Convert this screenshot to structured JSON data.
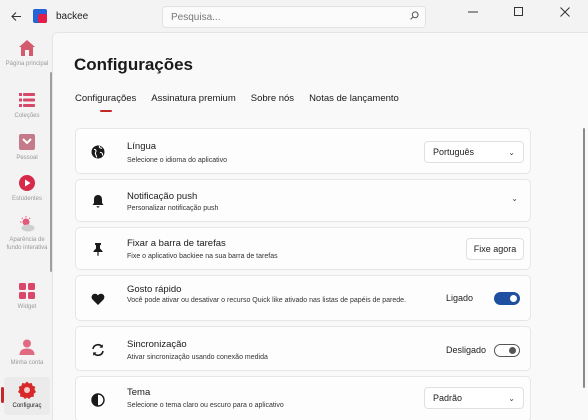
{
  "app": {
    "title": "backee"
  },
  "search": {
    "placeholder": "Pesquisa..."
  },
  "sidebar": {
    "items": [
      {
        "label": "Página principal",
        "icon": "home-icon"
      },
      {
        "label": "Coleções",
        "icon": "collections-icon"
      },
      {
        "label": "Pessoal",
        "icon": "personal-icon"
      },
      {
        "label": "Estúdentes",
        "icon": "play-icon"
      },
      {
        "label": "Aparência de fundo interativa",
        "icon": "weather-icon"
      },
      {
        "label": "Widget",
        "icon": "widget-icon"
      },
      {
        "label": "Minha conta",
        "icon": "user-icon"
      },
      {
        "label": "Configuraç",
        "icon": "settings-icon"
      }
    ]
  },
  "page": {
    "title": "Configurações"
  },
  "tabs": [
    {
      "label": "Configurações"
    },
    {
      "label": "Assinatura premium"
    },
    {
      "label": "Sobre nós"
    },
    {
      "label": "Notas de lançamento"
    }
  ],
  "settings": {
    "language": {
      "title": "Língua",
      "subtitle": "Selecione o idioma do aplicativo",
      "value": "Português"
    },
    "push": {
      "title": "Notificação push",
      "subtitle": "Personalizar notificação push"
    },
    "taskbar": {
      "title": "Fixar a barra de tarefas",
      "subtitle": "Fixe o aplicativo backiee na sua barra de tarefas",
      "button": "Fixe agora"
    },
    "like": {
      "title": "Gosto rápido",
      "subtitle": "Você pode ativar ou desativar o recurso Quick like ativado nas listas de papéis de parede.",
      "state": "Ligado"
    },
    "sync": {
      "title": "Sincronização",
      "subtitle": "Ativar sincronização usando conexão medida",
      "state": "Desligado"
    },
    "theme": {
      "title": "Tema",
      "subtitle": "Selecione o tema claro ou escuro para o aplicativo",
      "value": "Padrão"
    }
  },
  "colors": {
    "accent": "#c62828",
    "toggle_on": "#1f4fa0"
  }
}
